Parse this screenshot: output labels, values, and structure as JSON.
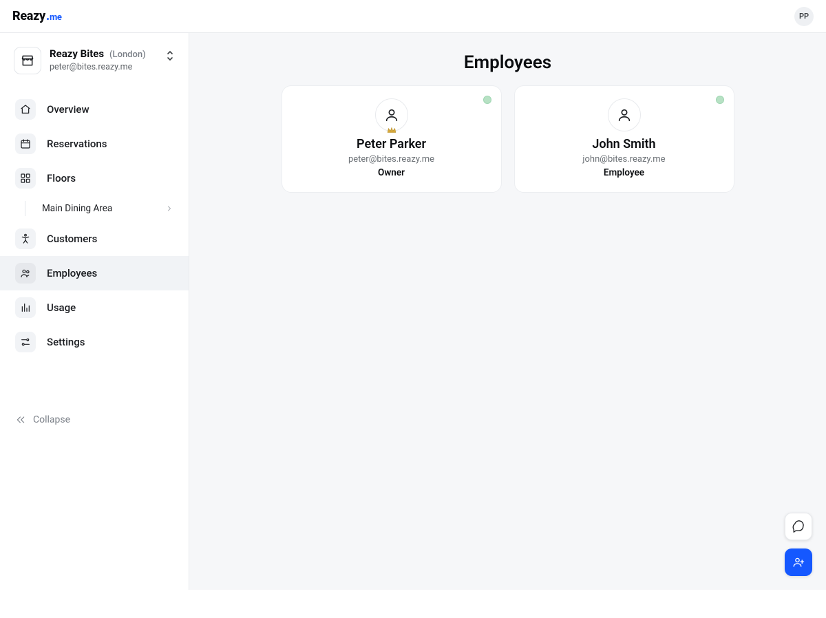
{
  "brand": {
    "name": "Reazy",
    "suffix": ".me"
  },
  "user": {
    "initials": "PP"
  },
  "account": {
    "name": "Reazy Bites",
    "location": "(London)",
    "email": "peter@bites.reazy.me"
  },
  "sidebar": {
    "items": [
      {
        "key": "overview",
        "label": "Overview"
      },
      {
        "key": "reservations",
        "label": "Reservations"
      },
      {
        "key": "floors",
        "label": "Floors"
      },
      {
        "key": "customers",
        "label": "Customers"
      },
      {
        "key": "employees",
        "label": "Employees"
      },
      {
        "key": "usage",
        "label": "Usage"
      },
      {
        "key": "settings",
        "label": "Settings"
      }
    ],
    "floors_children": [
      {
        "label": "Main Dining Area"
      }
    ],
    "active": "employees",
    "collapse_label": "Collapse"
  },
  "page": {
    "title": "Employees",
    "employees": [
      {
        "name": "Peter Parker",
        "email": "peter@bites.reazy.me",
        "role": "Owner",
        "status": "active",
        "owner": true
      },
      {
        "name": "John Smith",
        "email": "john@bites.reazy.me",
        "role": "Employee",
        "status": "active",
        "owner": false
      }
    ]
  },
  "colors": {
    "accent": "#1558ff",
    "status_active": "#b7e1c4"
  }
}
